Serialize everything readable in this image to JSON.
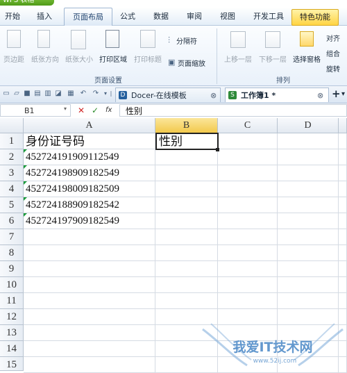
{
  "app": {
    "badge": "WPS 表格"
  },
  "menu": {
    "tabs": [
      "开始",
      "插入",
      "页面布局",
      "公式",
      "数据",
      "审阅",
      "视图",
      "开发工具",
      "特色功能"
    ],
    "active": "页面布局"
  },
  "ribbon": {
    "page_setup": {
      "buttons": [
        "页边距",
        "纸张方向",
        "纸张大小",
        "打印区域",
        "打印标题"
      ],
      "separator": "分隔符",
      "page_zoom": "页面缩放",
      "group_label": "页面设置"
    },
    "arrange": {
      "buttons": [
        "上移一层",
        "下移一层",
        "选择窗格"
      ],
      "side": [
        "对齐",
        "组合",
        "旋转"
      ],
      "group_label": "排列"
    }
  },
  "doc_tabs": {
    "template_tab": "Docer-在线模板",
    "workbook_tab": "工作簿1 *",
    "close_glyph": "⊗",
    "add_glyph": "+"
  },
  "formula_bar": {
    "name_box": "B1",
    "cancel_glyph": "✕",
    "confirm_glyph": "✓",
    "fx_glyph": "fx",
    "content": "性别"
  },
  "sheet": {
    "columns": [
      "A",
      "B",
      "C",
      "D"
    ],
    "selected_column": "B",
    "rows": [
      "1",
      "2",
      "3",
      "4",
      "5",
      "6",
      "7",
      "8",
      "9",
      "10",
      "11",
      "12",
      "13",
      "14",
      "15"
    ],
    "cells": {
      "A1": "身份证号码",
      "B1": "性别",
      "A2": "452724191909112549",
      "A3": "452724198909182549",
      "A4": "452724198009182509",
      "A5": "452724188909182542",
      "A6": "452724197909182549"
    }
  },
  "watermark": {
    "text": "我爱IT技术网",
    "url": "www.52ij.com"
  },
  "colors": {
    "active_tab": "#dde9f6",
    "special_tab": "#ffd444",
    "selected_header": "#f2c94c",
    "number_text_marker": "#1a9b3a",
    "watermark": "#3d7fc2"
  }
}
